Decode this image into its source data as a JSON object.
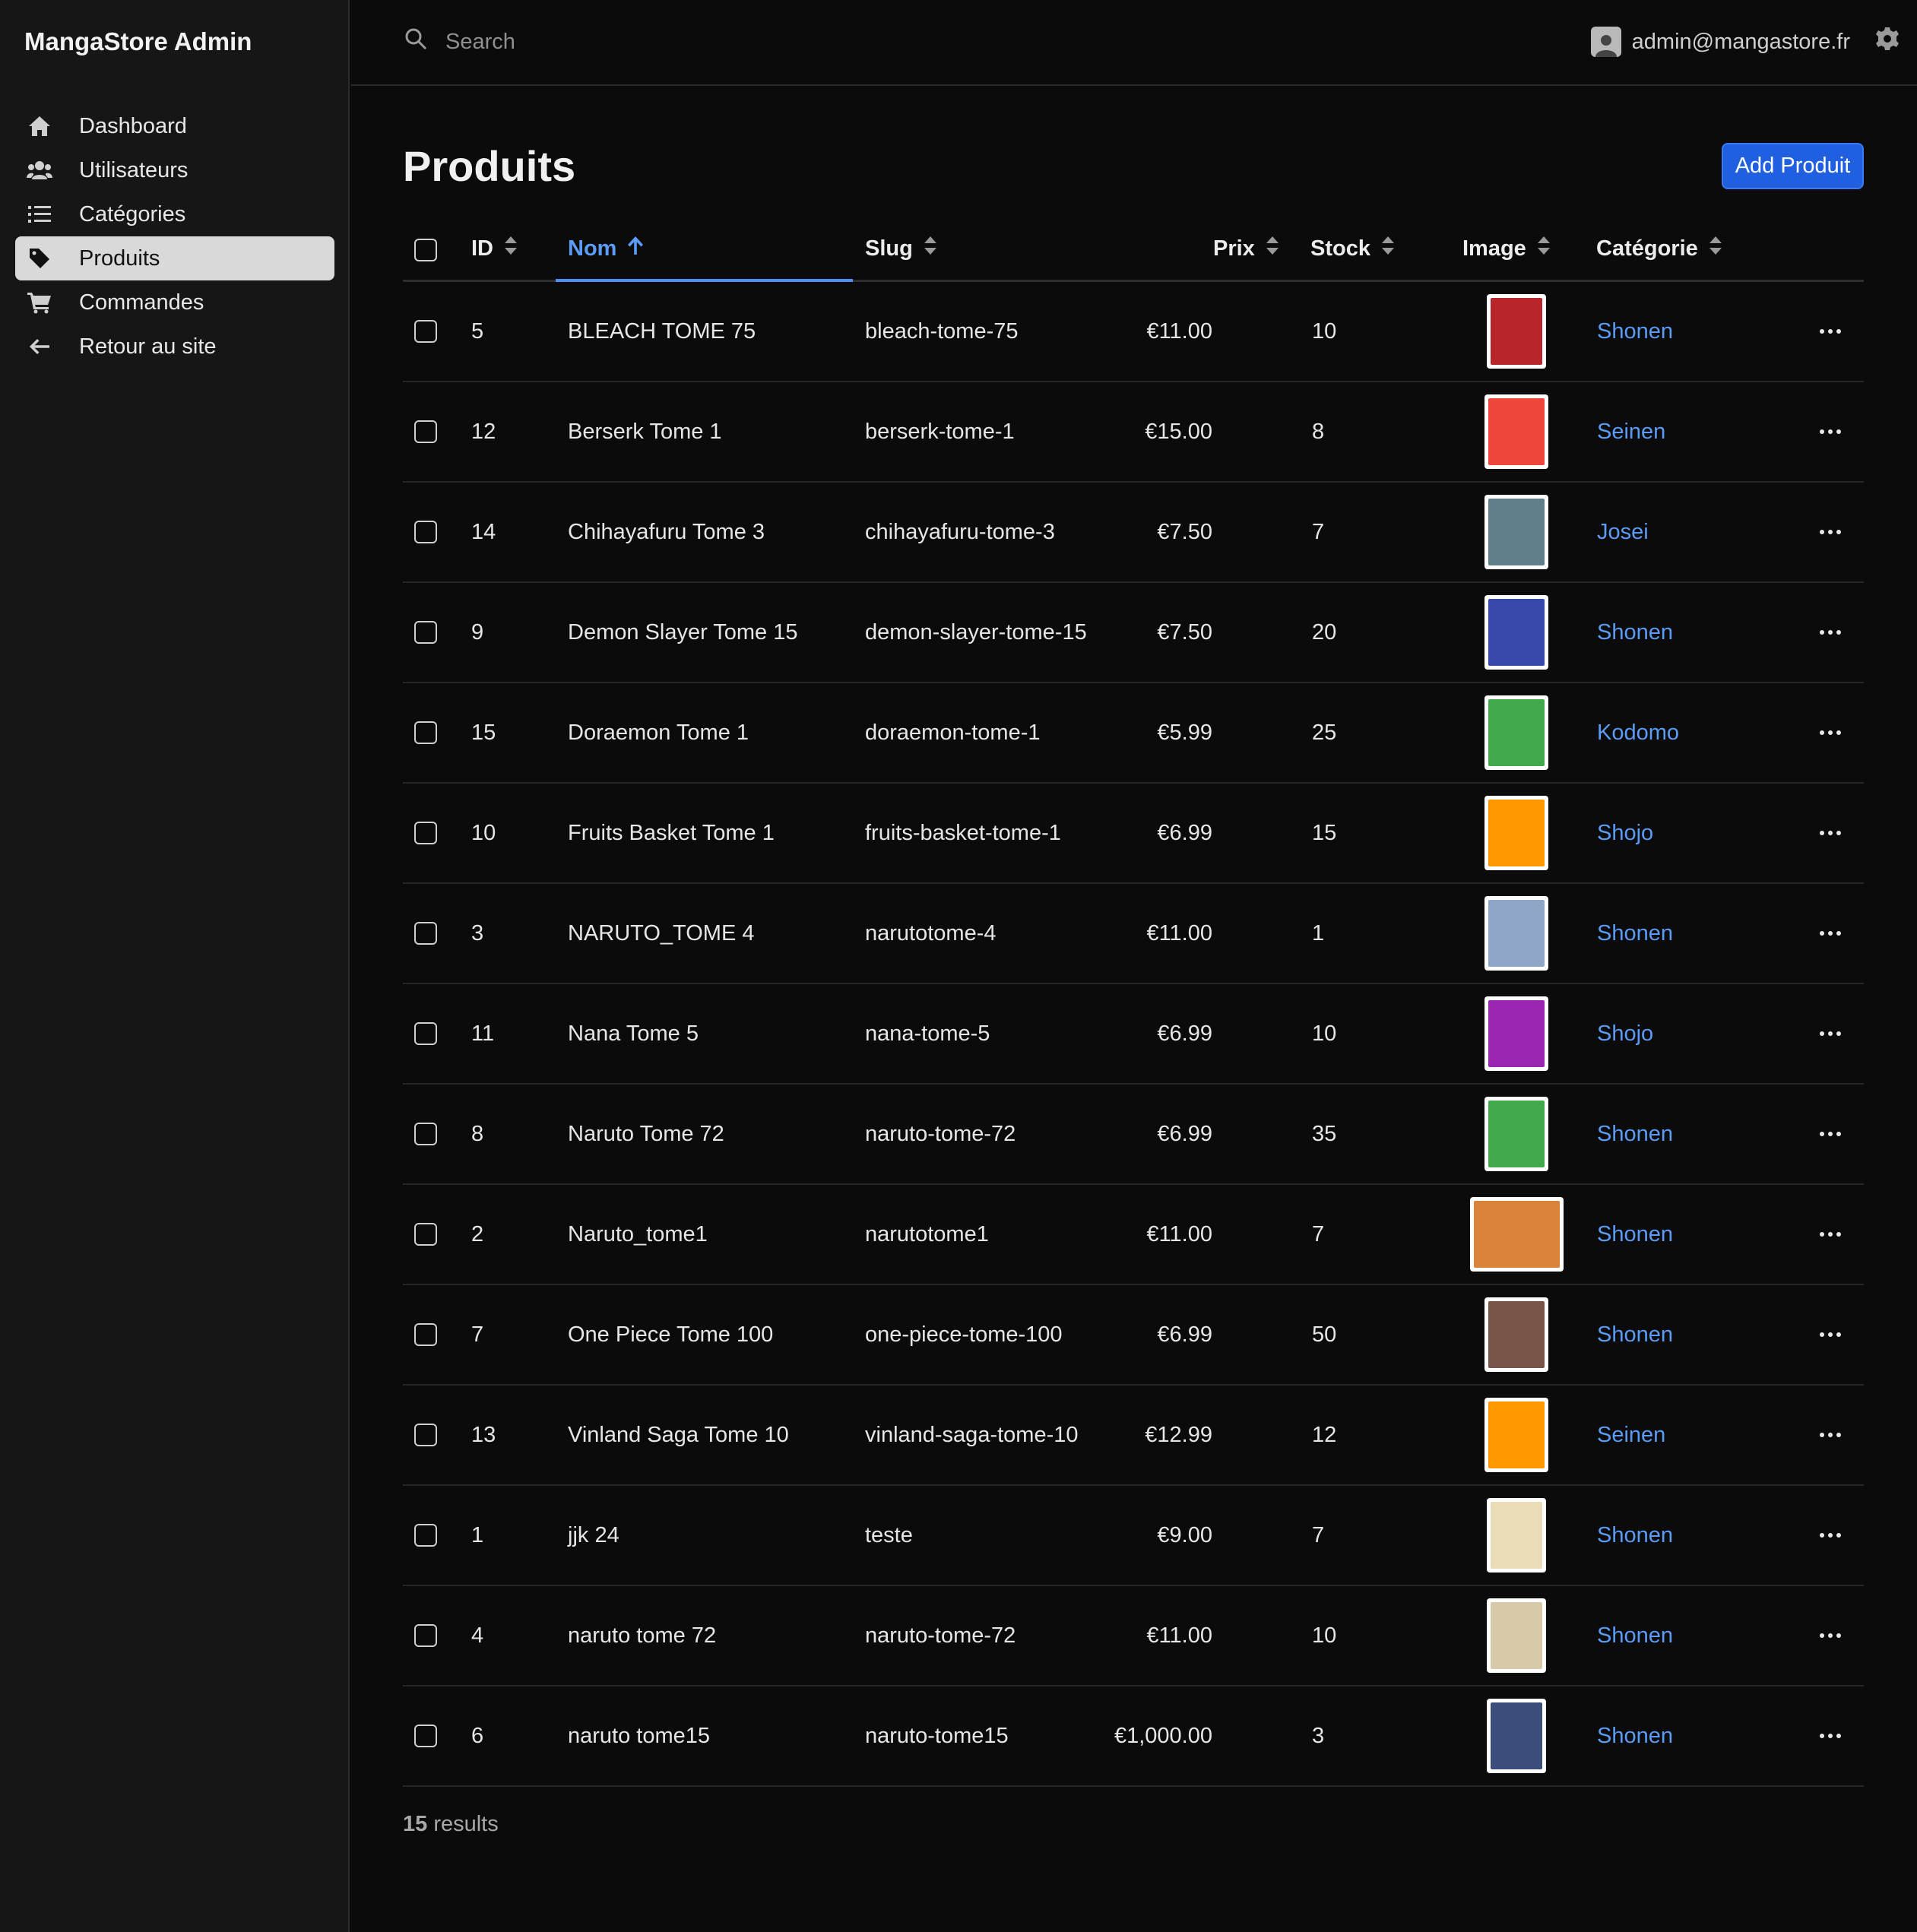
{
  "app": {
    "title": "MangaStore Admin"
  },
  "sidebar": {
    "items": [
      {
        "label": "Dashboard",
        "icon": "home-icon",
        "active": false
      },
      {
        "label": "Utilisateurs",
        "icon": "users-icon",
        "active": false
      },
      {
        "label": "Catégories",
        "icon": "list-icon",
        "active": false
      },
      {
        "label": "Produits",
        "icon": "tag-icon",
        "active": true
      },
      {
        "label": "Commandes",
        "icon": "cart-icon",
        "active": false
      },
      {
        "label": "Retour au site",
        "icon": "arrow-left-icon",
        "active": false
      }
    ]
  },
  "topbar": {
    "search_placeholder": "Search",
    "user_email": "admin@mangastore.fr"
  },
  "page": {
    "title": "Produits",
    "add_button": "Add Produit"
  },
  "table": {
    "columns": {
      "id": "ID",
      "nom": "Nom",
      "slug": "Slug",
      "prix": "Prix",
      "stock": "Stock",
      "image": "Image",
      "categorie": "Catégorie"
    },
    "sort": {
      "column": "Nom",
      "direction": "ascending"
    },
    "rows": [
      {
        "id": "5",
        "nom": "BLEACH TOME 75",
        "slug": "bleach-tome-75",
        "prix": "€11.00",
        "stock": "10",
        "categorie": "Shonen",
        "cover": "#b8262b",
        "thumb": "narrow"
      },
      {
        "id": "12",
        "nom": "Berserk Tome 1",
        "slug": "berserk-tome-1",
        "prix": "€15.00",
        "stock": "8",
        "categorie": "Seinen",
        "cover": "#f0463a",
        "thumb": "normal"
      },
      {
        "id": "14",
        "nom": "Chihayafuru Tome 3",
        "slug": "chihayafuru-tome-3",
        "prix": "€7.50",
        "stock": "7",
        "categorie": "Josei",
        "cover": "#5f7f8b",
        "thumb": "normal"
      },
      {
        "id": "9",
        "nom": "Demon Slayer Tome 15",
        "slug": "demon-slayer-tome-15",
        "prix": "€7.50",
        "stock": "20",
        "categorie": "Shonen",
        "cover": "#3949ab",
        "thumb": "normal"
      },
      {
        "id": "15",
        "nom": "Doraemon Tome 1",
        "slug": "doraemon-tome-1",
        "prix": "€5.99",
        "stock": "25",
        "categorie": "Kodomo",
        "cover": "#43a94d",
        "thumb": "normal"
      },
      {
        "id": "10",
        "nom": "Fruits Basket Tome 1",
        "slug": "fruits-basket-tome-1",
        "prix": "€6.99",
        "stock": "15",
        "categorie": "Shojo",
        "cover": "#ff9800",
        "thumb": "normal"
      },
      {
        "id": "3",
        "nom": "NARUTO_TOME 4",
        "slug": "narutotome-4",
        "prix": "€11.00",
        "stock": "1",
        "categorie": "Shonen",
        "cover": "#8fa6c6",
        "thumb": "normal"
      },
      {
        "id": "11",
        "nom": "Nana Tome 5",
        "slug": "nana-tome-5",
        "prix": "€6.99",
        "stock": "10",
        "categorie": "Shojo",
        "cover": "#9b27b0",
        "thumb": "normal"
      },
      {
        "id": "8",
        "nom": "Naruto Tome 72",
        "slug": "naruto-tome-72",
        "prix": "€6.99",
        "stock": "35",
        "categorie": "Shonen",
        "cover": "#43a94d",
        "thumb": "normal"
      },
      {
        "id": "2",
        "nom": "Naruto_tome1",
        "slug": "narutotome1",
        "prix": "€11.00",
        "stock": "7",
        "categorie": "Shonen",
        "cover": "#d9843a",
        "thumb": "wide"
      },
      {
        "id": "7",
        "nom": "One Piece Tome 100",
        "slug": "one-piece-tome-100",
        "prix": "€6.99",
        "stock": "50",
        "categorie": "Shonen",
        "cover": "#795548",
        "thumb": "normal"
      },
      {
        "id": "13",
        "nom": "Vinland Saga Tome 10",
        "slug": "vinland-saga-tome-10",
        "prix": "€12.99",
        "stock": "12",
        "categorie": "Seinen",
        "cover": "#ff9800",
        "thumb": "normal"
      },
      {
        "id": "1",
        "nom": "jjk 24",
        "slug": "teste",
        "prix": "€9.00",
        "stock": "7",
        "categorie": "Shonen",
        "cover": "#e9dcb8",
        "thumb": "narrow"
      },
      {
        "id": "4",
        "nom": "naruto tome 72",
        "slug": "naruto-tome-72",
        "prix": "€11.00",
        "stock": "10",
        "categorie": "Shonen",
        "cover": "#d8c9a8",
        "thumb": "narrow"
      },
      {
        "id": "6",
        "nom": "naruto tome15",
        "slug": "naruto-tome15",
        "prix": "€1,000.00",
        "stock": "3",
        "categorie": "Shonen",
        "cover": "#3b4d7a",
        "thumb": "narrow"
      }
    ]
  },
  "footer": {
    "count": "15",
    "label": "results"
  },
  "colors": {
    "accent": "#5b9cf6",
    "button": "#1f5fe0",
    "background": "#0b0b0c",
    "sidebar": "#161617"
  }
}
